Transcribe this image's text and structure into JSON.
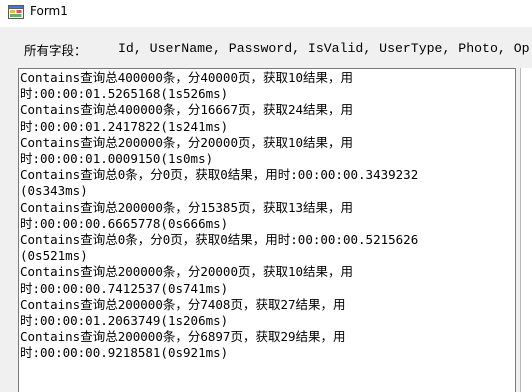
{
  "window": {
    "title": "Form1",
    "icon": "windows-form-icon"
  },
  "fields": {
    "label": "所有字段：",
    "value": "Id, UserName, Password, IsValid, UserType, Photo, Op"
  },
  "output": {
    "lines": [
      "Contains查询总400000条，分40000页，获取10结果，用",
      "时:00:00:01.5265168(1s526ms)",
      "Contains查询总400000条，分16667页，获取24结果，用",
      "时:00:00:01.2417822(1s241ms)",
      "Contains查询总200000条，分20000页，获取10结果，用",
      "时:00:00:01.0009150(1s0ms)",
      "Contains查询总0条，分0页，获取0结果，用时:00:00:00.3439232",
      "(0s343ms)",
      "Contains查询总200000条，分15385页，获取13结果，用",
      "时:00:00:00.6665778(0s666ms)",
      "Contains查询总0条，分0页，获取0结果，用时:00:00:00.5215626",
      "(0s521ms)",
      "Contains查询总200000条，分20000页，获取10结果，用",
      "时:00:00:00.7412537(0s741ms)",
      "Contains查询总200000条，分7408页，获取27结果，用",
      "时:00:00:01.2063749(1s206ms)",
      "Contains查询总200000条，分6897页，获取29结果，用",
      "时:00:00:00.9218581(0s921ms)"
    ]
  }
}
